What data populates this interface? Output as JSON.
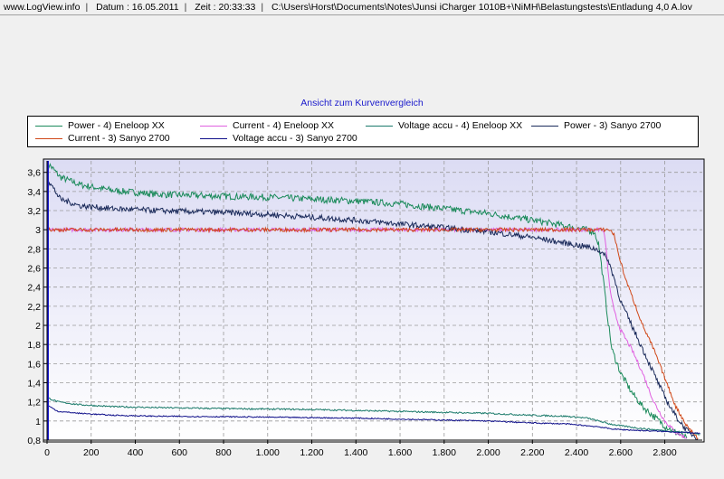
{
  "titlebar": {
    "site": "www.LogView.info",
    "date": "Datum : 16.05.2011",
    "time": "Zeit : 20:33:33",
    "path": "C:\\Users\\Horst\\Documents\\Notes\\Junsi iCharger 1010B+\\NiMH\\Belastungstests\\Entladung 4,0 A.lov"
  },
  "chart_data": {
    "type": "line",
    "title": "Ansicht zum Kurvenvergleich",
    "xlim": [
      0,
      2970
    ],
    "ylim": [
      0.8,
      3.72
    ],
    "x_ticks": [
      {
        "v": 0,
        "label": "0"
      },
      {
        "v": 200,
        "label": "200"
      },
      {
        "v": 400,
        "label": "400"
      },
      {
        "v": 600,
        "label": "600"
      },
      {
        "v": 800,
        "label": "800"
      },
      {
        "v": 1000,
        "label": "1.000"
      },
      {
        "v": 1200,
        "label": "1.200"
      },
      {
        "v": 1400,
        "label": "1.400"
      },
      {
        "v": 1600,
        "label": "1.600"
      },
      {
        "v": 1800,
        "label": "1.800"
      },
      {
        "v": 2000,
        "label": "2.000"
      },
      {
        "v": 2200,
        "label": "2.200"
      },
      {
        "v": 2400,
        "label": "2.400"
      },
      {
        "v": 2600,
        "label": "2.600"
      },
      {
        "v": 2800,
        "label": "2.800"
      }
    ],
    "y_ticks": [
      {
        "v": 0.8,
        "label": "0,8"
      },
      {
        "v": 1.0,
        "label": "1"
      },
      {
        "v": 1.2,
        "label": "1,2"
      },
      {
        "v": 1.4,
        "label": "1,4"
      },
      {
        "v": 1.6,
        "label": "1,6"
      },
      {
        "v": 1.8,
        "label": "1,8"
      },
      {
        "v": 2.0,
        "label": "2"
      },
      {
        "v": 2.2,
        "label": "2,2"
      },
      {
        "v": 2.4,
        "label": "2,4"
      },
      {
        "v": 2.6,
        "label": "2,6"
      },
      {
        "v": 2.8,
        "label": "2,8"
      },
      {
        "v": 3.0,
        "label": "3"
      },
      {
        "v": 3.2,
        "label": "3,2"
      },
      {
        "v": 3.4,
        "label": "3,4"
      },
      {
        "v": 3.6,
        "label": "3,6"
      }
    ],
    "grid": true,
    "legend_position": "top",
    "series": [
      {
        "name": "Power - 4) Eneloop XX",
        "color": "#1a8a5a",
        "noise": 0.035,
        "x": [
          0,
          10,
          60,
          150,
          300,
          500,
          800,
          1000,
          1200,
          1400,
          1600,
          1800,
          2000,
          2200,
          2350,
          2420,
          2480,
          2500,
          2520,
          2540,
          2560,
          2600,
          2650,
          2700,
          2750,
          2800,
          2850,
          2900
        ],
        "y": [
          3.6,
          3.68,
          3.55,
          3.47,
          3.41,
          3.37,
          3.35,
          3.34,
          3.32,
          3.3,
          3.27,
          3.22,
          3.17,
          3.1,
          3.04,
          3.01,
          2.98,
          2.85,
          2.5,
          2.1,
          1.75,
          1.5,
          1.3,
          1.15,
          1.05,
          0.95,
          0.88,
          0.82
        ]
      },
      {
        "name": "Current - 4) Eneloop XX",
        "color": "#e060e0",
        "noise": 0.02,
        "x": [
          0,
          10,
          2520,
          2530,
          2550,
          2570,
          2600,
          2650,
          2700,
          2750,
          2800,
          2850,
          2900
        ],
        "y": [
          3.0,
          3.0,
          3.0,
          2.9,
          2.4,
          2.15,
          1.95,
          1.75,
          1.5,
          1.2,
          1.0,
          0.88,
          0.82
        ]
      },
      {
        "name": "Voltage accu - 4) Eneloop XX",
        "color": "#1a7a6a",
        "noise": 0.008,
        "x": [
          0,
          5,
          50,
          150,
          300,
          500,
          800,
          1000,
          1200,
          1400,
          1600,
          1800,
          2000,
          2200,
          2350,
          2450,
          2500,
          2550,
          2600,
          2700,
          2800,
          2900,
          2960
        ],
        "y": [
          1.2,
          1.24,
          1.2,
          1.17,
          1.15,
          1.14,
          1.13,
          1.125,
          1.12,
          1.11,
          1.1,
          1.09,
          1.08,
          1.06,
          1.05,
          1.03,
          1.0,
          0.97,
          0.95,
          0.92,
          0.9,
          0.88,
          0.86
        ]
      },
      {
        "name": "Power - 3) Sanyo 2700",
        "color": "#1a2a5a",
        "noise": 0.03,
        "x": [
          0,
          10,
          60,
          150,
          300,
          500,
          800,
          1000,
          1200,
          1400,
          1600,
          1800,
          2000,
          2200,
          2350,
          2450,
          2500,
          2540,
          2570,
          2600,
          2650,
          2700,
          2750,
          2800,
          2850,
          2900,
          2950
        ],
        "y": [
          3.45,
          3.5,
          3.32,
          3.25,
          3.22,
          3.2,
          3.18,
          3.16,
          3.13,
          3.1,
          3.06,
          3.02,
          2.98,
          2.92,
          2.86,
          2.82,
          2.79,
          2.7,
          2.5,
          2.25,
          2.0,
          1.75,
          1.5,
          1.25,
          1.05,
          0.9,
          0.82
        ]
      },
      {
        "name": "Current - 3) Sanyo 2700",
        "color": "#d04818",
        "noise": 0.02,
        "x": [
          0,
          10,
          2550,
          2570,
          2590,
          2620,
          2660,
          2700,
          2750,
          2800,
          2850,
          2900,
          2950
        ],
        "y": [
          3.0,
          3.0,
          3.0,
          2.95,
          2.75,
          2.5,
          2.25,
          2.0,
          1.75,
          1.45,
          1.15,
          0.95,
          0.82
        ]
      },
      {
        "name": "Voltage accu - 3) Sanyo 2700",
        "color": "#10108a",
        "noise": 0.006,
        "x": [
          0,
          5,
          50,
          150,
          300,
          500,
          800,
          1000,
          1200,
          1400,
          1600,
          1800,
          2000,
          2200,
          2350,
          2400,
          2450,
          2500,
          2550,
          2600,
          2700,
          2800,
          2900,
          2960
        ],
        "y": [
          1.12,
          1.16,
          1.1,
          1.08,
          1.06,
          1.05,
          1.045,
          1.04,
          1.035,
          1.03,
          1.02,
          1.01,
          1.0,
          0.98,
          0.97,
          0.96,
          0.95,
          0.94,
          0.92,
          0.91,
          0.9,
          0.89,
          0.88,
          0.87
        ]
      }
    ]
  }
}
